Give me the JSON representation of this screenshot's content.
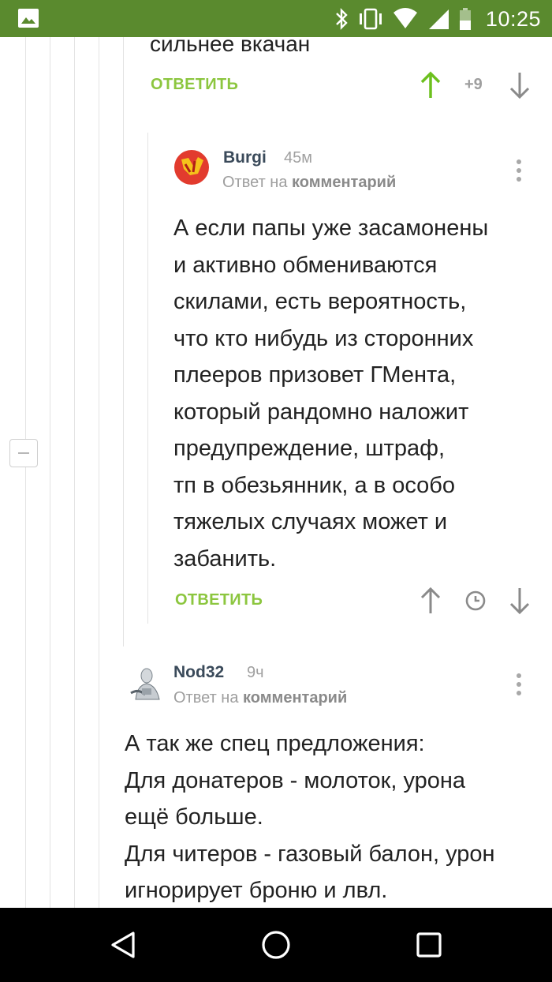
{
  "status_bar": {
    "time": "10:25",
    "icons": [
      "image-icon",
      "bluetooth-icon",
      "vibrate-icon",
      "wifi-icon",
      "signal-icon",
      "battery-icon"
    ]
  },
  "top_comment": {
    "text_tail": "сильнее вкачан",
    "reply_label": "ОТВЕТИТЬ",
    "score": "+9"
  },
  "comment_burgi": {
    "username": "Burgi",
    "time": "45м",
    "reply_prefix": "Ответ на",
    "reply_target": "комментарий",
    "body": "А если папы уже засамонены\nи активно обмениваются\nскилами, есть вероятность,\nчто кто нибудь из сторонних\nплееров призовет ГМента,\nкоторый рандомно наложит\nпредупреждение, штраф,\nтп в обезьянник, а в особо\nтяжелых случаях может и\nзабанить.",
    "reply_label": "ОТВЕТИТЬ"
  },
  "comment_nod32": {
    "username": "Nod32",
    "time": "9ч",
    "reply_prefix": "Ответ на",
    "reply_target": "комментарий",
    "body": "А так же спец предложения:\nДля донатеров - молоток, урона\nещё больше.\nДля читеров - газовый балон, урон\nигнорирует броню и лвл."
  },
  "colors": {
    "status_bar": "#5a8a2e",
    "accent_green": "#8cc63f",
    "upvoted_arrow": "#6cc01e",
    "muted": "#9e9e9e"
  }
}
